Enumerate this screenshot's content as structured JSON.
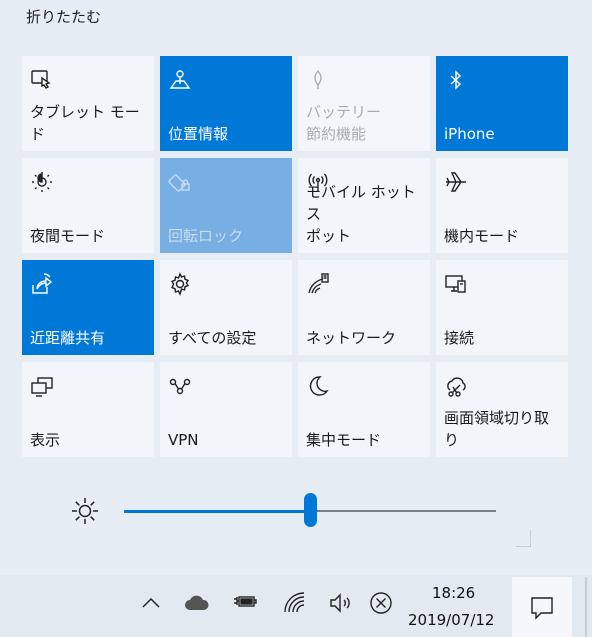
{
  "header": {
    "collapse_label": "折りたたむ"
  },
  "tiles": [
    {
      "label": "タブレット モード",
      "icon": "tablet-mode-icon"
    },
    {
      "label": "位置情報",
      "icon": "location-icon"
    },
    {
      "label": "バッテリー\n節約機能",
      "icon": "battery-saver-icon"
    },
    {
      "label": "iPhone",
      "icon": "bluetooth-icon"
    },
    {
      "label": "夜間モード",
      "icon": "night-light-icon"
    },
    {
      "label": "回転ロック",
      "icon": "rotation-lock-icon"
    },
    {
      "label": "モバイル ホットス\nポット",
      "icon": "mobile-hotspot-icon"
    },
    {
      "label": "機内モード",
      "icon": "airplane-icon"
    },
    {
      "label": "近距離共有",
      "icon": "nearby-share-icon"
    },
    {
      "label": "すべての設定",
      "icon": "gear-icon"
    },
    {
      "label": "ネットワーク",
      "icon": "network-icon"
    },
    {
      "label": "接続",
      "icon": "connect-icon"
    },
    {
      "label": "表示",
      "icon": "project-display-icon"
    },
    {
      "label": "VPN",
      "icon": "vpn-icon"
    },
    {
      "label": "集中モード",
      "icon": "focus-assist-moon-icon"
    },
    {
      "label": "画面領域切り取\nり",
      "icon": "screen-snip-icon"
    }
  ],
  "brightness": {
    "icon": "brightness-sun-icon",
    "level_percent": 51
  },
  "taskbar": {
    "time": "18:26",
    "date": "2019/07/12",
    "icons": [
      "chevron-up-icon",
      "onedrive-cloud-icon",
      "battery-plug-icon",
      "wifi-icon",
      "volume-icon",
      "mic-muted-icon"
    ]
  },
  "colors": {
    "accent": "#0078d7",
    "tile_off": "#f2f5f9",
    "panel_bg": "#e7edf4"
  }
}
